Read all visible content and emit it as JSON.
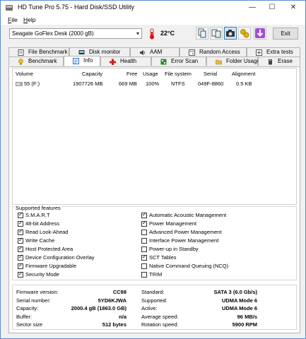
{
  "window": {
    "title": "HD Tune Pro 5.75 - Hard Disk/SSD Utility",
    "controls": {
      "minimize": "—",
      "maximize": "☐",
      "close": "✕"
    }
  },
  "menu": [
    {
      "pre": "",
      "u": "F",
      "post": "ile"
    },
    {
      "pre": "",
      "u": "H",
      "post": "elp"
    }
  ],
  "toolbar": {
    "drive": "Seagate GoFlex Desk (2000 gB)",
    "temperature": "22°C",
    "exit_label": "Exit"
  },
  "tabs_top": [
    {
      "label": "File Benchmark",
      "icon": "file-benchmark-icon",
      "color": "#555555"
    },
    {
      "label": "Disk monitor",
      "icon": "disk-monitor-icon",
      "color": "#333333"
    },
    {
      "label": "AAM",
      "icon": "speaker-icon",
      "color": "#444444"
    },
    {
      "label": "Random Access",
      "icon": "random-access-icon",
      "color": "#555555"
    },
    {
      "label": "Extra tests",
      "icon": "extra-tests-icon",
      "color": "#555555"
    }
  ],
  "tabs_bottom": [
    {
      "label": "Benchmark",
      "icon": "benchmark-icon",
      "color": "#d4a017"
    },
    {
      "label": "Info",
      "icon": "info-icon",
      "color": "#2a6fc9",
      "selected": true
    },
    {
      "label": "Health",
      "icon": "health-icon",
      "color": "#d11f1f"
    },
    {
      "label": "Error Scan",
      "icon": "error-scan-icon",
      "color": "#2b8a2b"
    },
    {
      "label": "Folder Usage",
      "icon": "folder-usage-icon",
      "color": "#d9a22a"
    },
    {
      "label": "Erase",
      "icon": "erase-icon",
      "color": "#444444"
    }
  ],
  "volumes": {
    "headers": [
      "Volume",
      "Capacity",
      "Free",
      "Usage",
      "File system",
      "Serial",
      "Alignment"
    ],
    "rows": [
      [
        "55 (F:)",
        "1907726 MB",
        "669 MB",
        "100%",
        "NTFS",
        "049F-8860",
        "0.5 KB"
      ]
    ]
  },
  "features": {
    "title": "Supported features",
    "left": [
      {
        "label": "S.M.A.R.T",
        "checked": true
      },
      {
        "label": "48-bit Address",
        "checked": true
      },
      {
        "label": "Read Look-Ahead",
        "checked": true
      },
      {
        "label": "Write Cache",
        "checked": true
      },
      {
        "label": "Host Protected Area",
        "checked": true
      },
      {
        "label": "Device Configuration Overlay",
        "checked": true
      },
      {
        "label": "Firmware Upgradable",
        "checked": true
      },
      {
        "label": "Security Mode",
        "checked": true
      }
    ],
    "right": [
      {
        "label": "Automatic Acoustic Management",
        "checked": true
      },
      {
        "label": "Power Management",
        "checked": true
      },
      {
        "label": "Advanced Power Management",
        "checked": false
      },
      {
        "label": "Interface Power Management",
        "checked": false
      },
      {
        "label": "Power-up in Standby",
        "checked": false
      },
      {
        "label": "SCT Tables",
        "checked": true
      },
      {
        "label": "Native Command Queuing (NCQ)",
        "checked": false
      },
      {
        "label": "TRIM",
        "checked": false
      }
    ]
  },
  "info": {
    "left": [
      {
        "label": "Firmware version:",
        "value": "CC98"
      },
      {
        "label": "Serial number:",
        "value": "5YD6KJWA"
      },
      {
        "label": "Capacity:",
        "value": "2000.4 gB (1863.0 GB)"
      },
      {
        "label": "Buffer:",
        "value": "n/a"
      },
      {
        "label": "Sector size",
        "value": "512 bytes"
      }
    ],
    "right": [
      {
        "label": "Standard:",
        "value": "SATA 3 (6.0 Gb/s)"
      },
      {
        "label": "Supported:",
        "value": "UDMA Mode 6"
      },
      {
        "label": "Active:",
        "value": "UDMA Mode 6"
      },
      {
        "label": "Average speed:",
        "value": "96 MB/s"
      },
      {
        "label": "Rotation speed:",
        "value": "5900 RPM"
      }
    ]
  }
}
